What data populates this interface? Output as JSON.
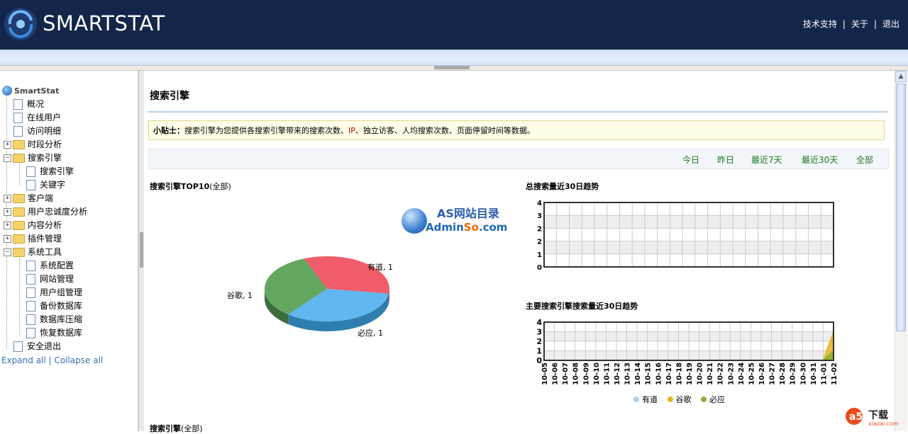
{
  "header": {
    "brand": "SMARTSTAT",
    "links": [
      "技术支持",
      "关于",
      "退出"
    ],
    "separator": "|"
  },
  "sidebar": {
    "root": "SmartStat",
    "items": [
      {
        "label": "概况",
        "kind": "page",
        "level": 1
      },
      {
        "label": "在线用户",
        "kind": "page",
        "level": 1
      },
      {
        "label": "访问明细",
        "kind": "page",
        "level": 1
      },
      {
        "label": "时段分析",
        "kind": "folder",
        "level": 1,
        "expanded": false
      },
      {
        "label": "搜索引擎",
        "kind": "folder",
        "level": 1,
        "expanded": true
      },
      {
        "label": "搜索引擎",
        "kind": "page",
        "level": 2
      },
      {
        "label": "关键字",
        "kind": "page",
        "level": 2
      },
      {
        "label": "客户端",
        "kind": "folder",
        "level": 1,
        "expanded": false
      },
      {
        "label": "用户忠诚度分析",
        "kind": "folder",
        "level": 1,
        "expanded": false
      },
      {
        "label": "内容分析",
        "kind": "folder",
        "level": 1,
        "expanded": false
      },
      {
        "label": "插件管理",
        "kind": "folder",
        "level": 1,
        "expanded": false
      },
      {
        "label": "系统工具",
        "kind": "folder",
        "level": 1,
        "expanded": true
      },
      {
        "label": "系统配置",
        "kind": "page",
        "level": 2
      },
      {
        "label": "网站管理",
        "kind": "page",
        "level": 2
      },
      {
        "label": "用户组管理",
        "kind": "page",
        "level": 2
      },
      {
        "label": "备份数据库",
        "kind": "page",
        "level": 2
      },
      {
        "label": "数据库压缩",
        "kind": "page",
        "level": 2
      },
      {
        "label": "恢复数据库",
        "kind": "page",
        "level": 2
      },
      {
        "label": "安全退出",
        "kind": "page",
        "level": 1
      }
    ],
    "expand_all": "Expand all",
    "collapse_all": "Collapse all",
    "link_separator": "|"
  },
  "main": {
    "title": "搜索引擎",
    "tip": {
      "label": "小贴士：",
      "text_before": "搜索引擎为您提供各搜索引擎带来的搜索次数、",
      "highlight": "IP",
      "text_after": "、独立访客、人均搜索次数、页面停留时间等数据。"
    },
    "ranges": [
      "今日",
      "昨日",
      "最近7天",
      "最近30天",
      "全部"
    ],
    "pie_title": "搜索引擎TOP10",
    "pie_title_sub": "(全部)",
    "line1_title": "总搜索量近30日趋势",
    "line2_title": "主要搜索引擎搜索量近30日趋势",
    "bottom_title": "搜索引擎",
    "bottom_title_sub": "(全部)"
  },
  "watermark": {
    "line1": "AS网站目录",
    "line2_a": "Admin",
    "line2_b": "So",
    "line2_c": ".com"
  },
  "footer_logo": {
    "text": "下载",
    "sub": "xiazai.com"
  },
  "colors": {
    "header_bg": "#13264a",
    "range_link": "#1a7a1a",
    "youdao": "#a8d2f0",
    "google": "#e6b422",
    "biying": "#8ab033"
  },
  "chart_data": [
    {
      "type": "pie",
      "title": "搜索引擎TOP10(全部)",
      "slices": [
        {
          "name": "有道",
          "value": 1,
          "color": "#f15c6a"
        },
        {
          "name": "必应",
          "value": 1,
          "color": "#61b7ef"
        },
        {
          "name": "谷歌",
          "value": 1,
          "color": "#63a761"
        }
      ],
      "labels": [
        "有道, 1",
        "必应, 1",
        "谷歌, 1"
      ]
    },
    {
      "type": "line",
      "title": "总搜索量近30日趋势",
      "ytick_labels": [
        "4",
        "3",
        "2",
        "2",
        "1",
        "0"
      ],
      "ylim": [
        0,
        4
      ],
      "series": []
    },
    {
      "type": "area",
      "title": "主要搜索引擎搜索量近30日趋势",
      "ytick_labels": [
        "4",
        "3",
        "2",
        "1",
        "0"
      ],
      "ylim": [
        0,
        4
      ],
      "categories": [
        "10-05",
        "10-06",
        "10-07",
        "10-08",
        "10-09",
        "10-10",
        "10-11",
        "10-12",
        "10-13",
        "10-14",
        "10-15",
        "10-16",
        "10-17",
        "10-18",
        "10-19",
        "10-20",
        "10-21",
        "10-22",
        "10-23",
        "10-24",
        "10-25",
        "10-26",
        "10-27",
        "10-28",
        "10-29",
        "10-30",
        "10-31",
        "11-01",
        "11-02"
      ],
      "series": [
        {
          "name": "有道",
          "color": "#a8d2f0",
          "values": [
            0,
            0,
            0,
            0,
            0,
            0,
            0,
            0,
            0,
            0,
            0,
            0,
            0,
            0,
            0,
            0,
            0,
            0,
            0,
            0,
            0,
            0,
            0,
            0,
            0,
            0,
            0,
            0,
            1
          ]
        },
        {
          "name": "谷歌",
          "color": "#e6b422",
          "values": [
            0,
            0,
            0,
            0,
            0,
            0,
            0,
            0,
            0,
            0,
            0,
            0,
            0,
            0,
            0,
            0,
            0,
            0,
            0,
            0,
            0,
            0,
            0,
            0,
            0,
            0,
            0,
            0,
            3
          ]
        },
        {
          "name": "必应",
          "color": "#8ab033",
          "values": [
            0,
            0,
            0,
            0,
            0,
            0,
            0,
            0,
            0,
            0,
            0,
            0,
            0,
            0,
            0,
            0,
            0,
            0,
            0,
            0,
            0,
            0,
            0,
            0,
            0,
            0,
            0,
            0,
            1
          ]
        }
      ]
    }
  ]
}
